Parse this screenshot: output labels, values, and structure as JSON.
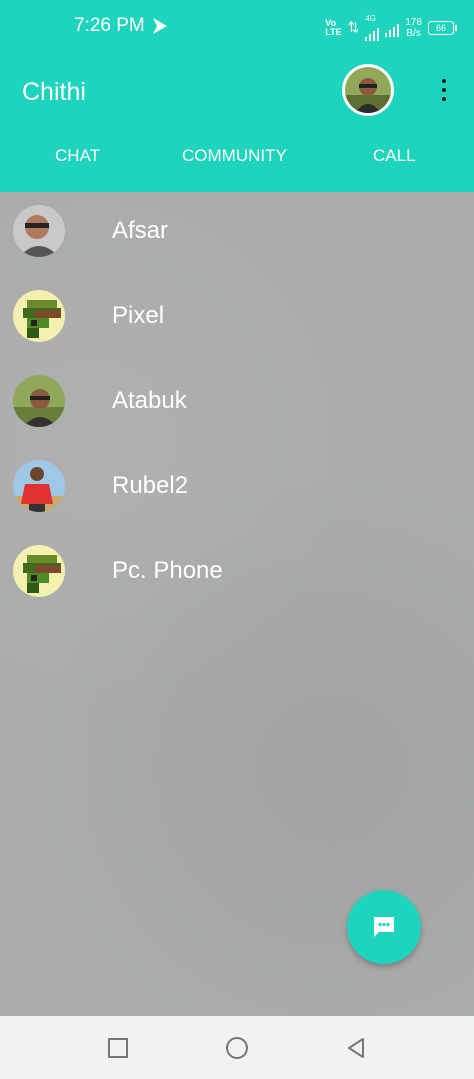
{
  "status_bar": {
    "time": "7:26 PM",
    "volte_top": "Vo",
    "volte_bottom": "LTE",
    "network": "4G",
    "speed_value": "178",
    "speed_unit": "B/s",
    "battery": "66"
  },
  "app_bar": {
    "title": "Chithi",
    "tabs": [
      {
        "label": "CHAT"
      },
      {
        "label": "COMMUNITY"
      },
      {
        "label": "CALL"
      }
    ]
  },
  "chats": [
    {
      "name": "Afsar",
      "avatar": "photo-man-sunglasses"
    },
    {
      "name": "Pixel",
      "avatar": "pixel-art"
    },
    {
      "name": "Atabuk",
      "avatar": "photo-man-outdoor"
    },
    {
      "name": "Rubel2",
      "avatar": "photo-man-red-shirt"
    },
    {
      "name": "Pc. Phone",
      "avatar": "pixel-art"
    }
  ],
  "fab": {
    "icon": "chat-bubble-icon"
  },
  "colors": {
    "accent": "#1ed4bd",
    "background": "#a9acab"
  }
}
